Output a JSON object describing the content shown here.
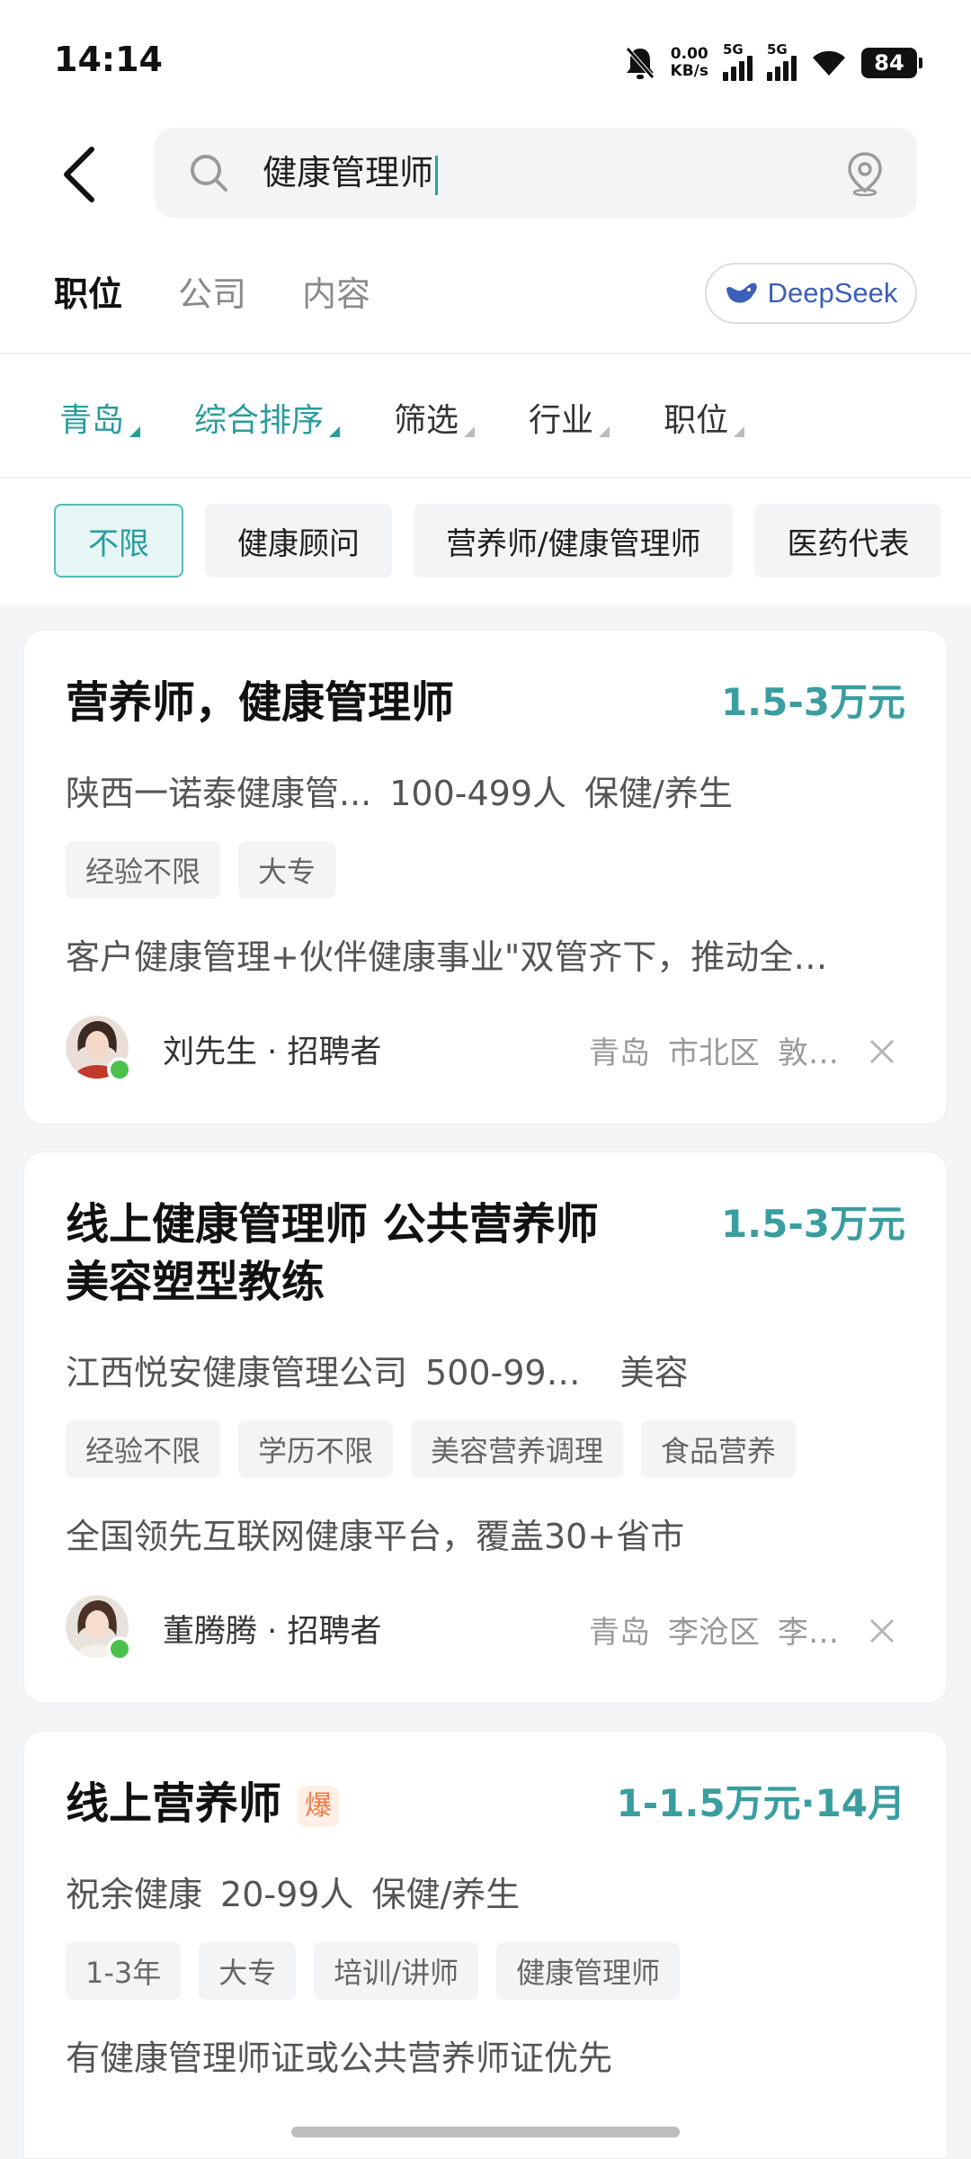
{
  "status_bar": {
    "time": "14:14",
    "net_speed_value": "0.00",
    "net_speed_unit": "KB/s",
    "signal1": "5G",
    "signal2": "5G",
    "battery": "84",
    "icons": [
      "bell-off-icon",
      "signal-icon",
      "wifi-icon",
      "battery-icon"
    ]
  },
  "search": {
    "query": "健康管理师",
    "icons": [
      "back-arrow-icon",
      "search-icon",
      "location-pin-icon"
    ]
  },
  "tabs": [
    {
      "label": "职位",
      "active": true
    },
    {
      "label": "公司",
      "active": false
    },
    {
      "label": "内容",
      "active": false
    }
  ],
  "deepseek": {
    "label": "DeepSeek"
  },
  "filters": [
    {
      "label": "青岛",
      "active": true
    },
    {
      "label": "综合排序",
      "active": true
    },
    {
      "label": "筛选",
      "active": false
    },
    {
      "label": "行业",
      "active": false
    },
    {
      "label": "职位",
      "active": false
    }
  ],
  "chips": [
    {
      "label": "不限",
      "active": true
    },
    {
      "label": "健康顾问",
      "active": false
    },
    {
      "label": "营养师/健康管理师",
      "active": false
    },
    {
      "label": "医药代表",
      "active": false
    }
  ],
  "jobs": [
    {
      "title": "营养师，健康管理师",
      "salary": "1.5-3万元",
      "company": "陕西一诺泰健康管...",
      "size": "100-499人",
      "industry": "保健/养生",
      "tags": [
        "经验不限",
        "大专"
      ],
      "desc": "客户健康管理+伙伴健康事业\"双管齐下，推动全…",
      "recruiter": "刘先生 · 招聘者",
      "city": "青岛",
      "district": "市北区",
      "area": "敦…"
    },
    {
      "title_line1": "线上健康管理师  公共营养师",
      "title_line2": "美容塑型教练",
      "salary": "1.5-3万元",
      "company": "江西悦安健康管理公司",
      "size": "500-99…",
      "industry": "美容",
      "tags": [
        "经验不限",
        "学历不限",
        "美容营养调理",
        "食品营养"
      ],
      "desc": "全国领先互联网健康平台，覆盖30+省市",
      "recruiter": "董腾腾 · 招聘者",
      "city": "青岛",
      "district": "李沧区",
      "area": "李…"
    },
    {
      "title": "线上营养师",
      "badge": "爆",
      "salary": "1-1.5万元·14月",
      "company": "祝余健康",
      "size": "20-99人",
      "industry": "保健/养生",
      "tags": [
        "1-3年",
        "大专",
        "培训/讲师",
        "健康管理师"
      ],
      "desc": "有健康管理师证或公共营养师证优先"
    }
  ],
  "colors": {
    "accent": "#2a9c9c",
    "salary": "#3a9da0",
    "online": "#4cc04c",
    "deepseek": "#3c5fb7"
  }
}
